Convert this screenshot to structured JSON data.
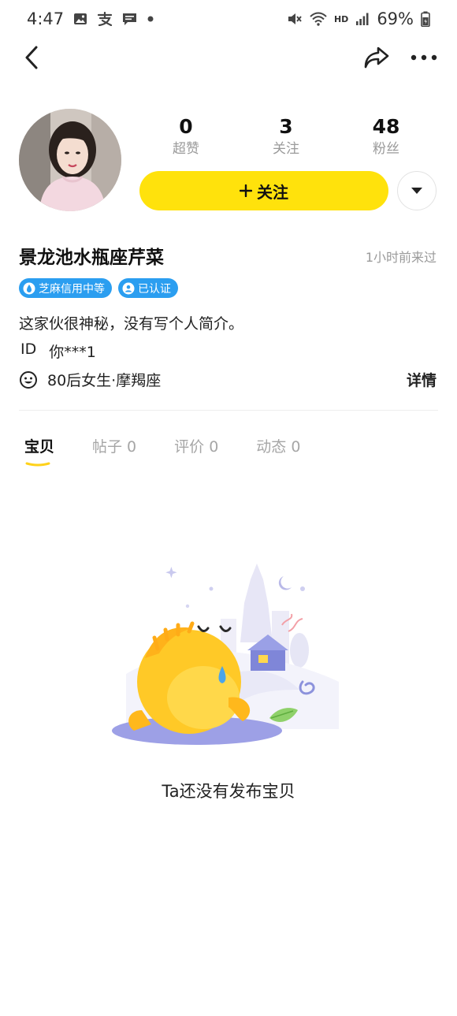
{
  "status_bar": {
    "time": "4:47",
    "battery": "69%",
    "network": "HD",
    "icons": [
      "image-icon",
      "alipay-icon",
      "message-icon",
      "dot-icon",
      "mute-icon",
      "wifi-icon",
      "signal-icon",
      "battery-icon"
    ]
  },
  "nav": {
    "icons": [
      "back-icon",
      "share-icon",
      "more-icon"
    ]
  },
  "profile": {
    "stats": [
      {
        "value": "0",
        "label": "超赞"
      },
      {
        "value": "3",
        "label": "关注"
      },
      {
        "value": "48",
        "label": "粉丝"
      }
    ],
    "follow_label": "关注",
    "username": "景龙池水瓶座芹菜",
    "last_seen": "1小时前来过",
    "badges": [
      {
        "label": "芝麻信用中等",
        "icon": "credit-icon"
      },
      {
        "label": "已认证",
        "icon": "verified-icon"
      }
    ],
    "bio": "这家伙很神秘，没有写个人简介。",
    "id_label": "ID",
    "id_value": "你***1",
    "tags": "80后女生·摩羯座",
    "details_label": "详情"
  },
  "tabs": [
    {
      "label": "宝贝",
      "active": true
    },
    {
      "label": "帖子 0",
      "active": false
    },
    {
      "label": "评价 0",
      "active": false
    },
    {
      "label": "动态 0",
      "active": false
    }
  ],
  "empty_state": {
    "message": "Ta还没有发布宝贝"
  },
  "colors": {
    "accent_yellow": "#ffe20c",
    "badge_blue": "#2b9ef0",
    "muted_text": "#9a9a9a"
  }
}
